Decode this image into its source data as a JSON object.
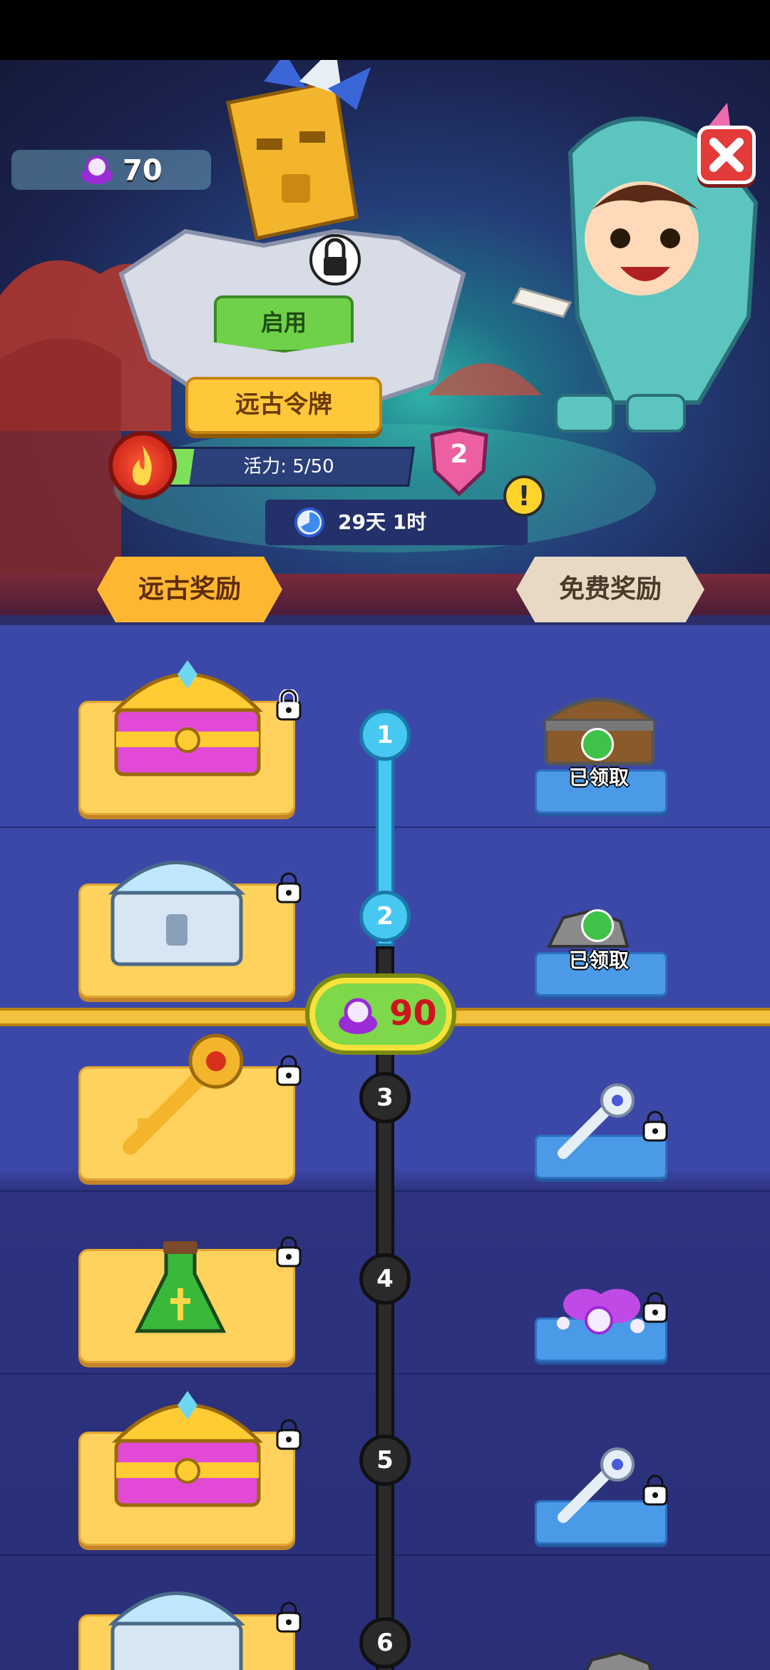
{
  "hud": {
    "gems": "70"
  },
  "hero": {
    "enable_label": "启用",
    "token_title": "远古令牌",
    "energy_label": "活力: 5/50",
    "energy_fraction": 0.1,
    "level": "2",
    "timer": "29天 1时",
    "alert": "!"
  },
  "tabs": {
    "ancient": "远古奖励",
    "free": "免费奖励"
  },
  "progress": {
    "value": "90"
  },
  "tiers": [
    {
      "num": "1",
      "status": "done",
      "ancient": "pink-gold-chest",
      "free": "wooden-chest",
      "free_claimed": "已领取"
    },
    {
      "num": "2",
      "status": "done",
      "ancient": "silver-chest",
      "free": "stone-pile",
      "free_claimed": "已领取"
    },
    {
      "num": "3",
      "status": "locked",
      "ancient": "golden-key",
      "free": "silver-key"
    },
    {
      "num": "4",
      "status": "locked",
      "ancient": "green-potion",
      "free": "pearl-pile"
    },
    {
      "num": "5",
      "status": "locked",
      "ancient": "pink-gold-chest",
      "free": "silver-key"
    },
    {
      "num": "6",
      "status": "locked",
      "ancient": "silver-chest",
      "free": "stone-pile"
    }
  ],
  "colors": {
    "gold_card": "#ffd25e",
    "free_card": "#4a9ae8",
    "done_node": "#47c8f0",
    "locked_node": "#2a2a2a",
    "progress_text": "#d0141f"
  }
}
